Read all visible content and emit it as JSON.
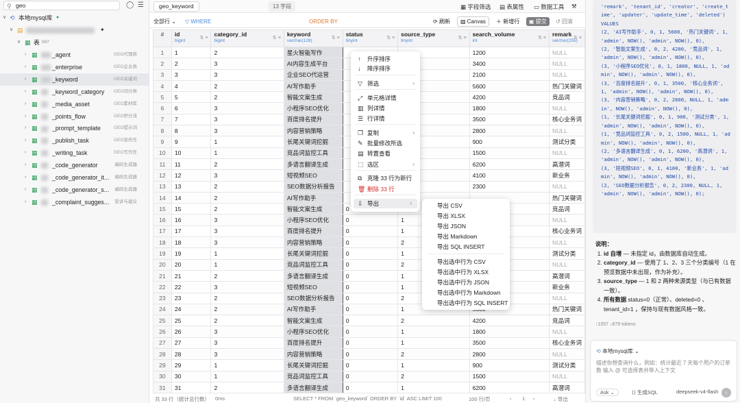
{
  "sidebar": {
    "search_value": "geo",
    "root_label": "本地mysql库",
    "tables_label": "表",
    "tables_count": "597",
    "items": [
      {
        "label": "_agent",
        "note": "GEO代理商"
      },
      {
        "label": "_enterprise",
        "note": "GEO企业表"
      },
      {
        "label": "_keyword",
        "note": "GEO关键词"
      },
      {
        "label": "_keyword_category",
        "note": "GEO词分类"
      },
      {
        "label": "_media_asset",
        "note": "GEO素材库"
      },
      {
        "label": "_points_flow",
        "note": "GEO积分流"
      },
      {
        "label": "_prompt_template",
        "note": "GEO提示词"
      },
      {
        "label": "_publish_task",
        "note": "GEO发布任"
      },
      {
        "label": "_writing_task",
        "note": "GEO写作任"
      },
      {
        "label": "_code_generator",
        "note": "编码生成器"
      },
      {
        "label": "_code_generator_it...",
        "note": "编码生成器"
      },
      {
        "label": "_code_generator_s...",
        "note": "编码生成器"
      },
      {
        "label": "_complaint_sugges...",
        "note": "投诉与建议"
      }
    ]
  },
  "toolbar": {
    "tab_label": "geo_keyword",
    "field_count": "13 字段",
    "field_filter": "字段筛选",
    "table_props": "表属性",
    "data_tools": "数据工具"
  },
  "filterbar": {
    "rows": "全部行",
    "where": "WHERE",
    "order_by": "ORDER BY",
    "refresh": "刷新",
    "canvas": "Canvas",
    "add_row": "新增行",
    "commit": "提交",
    "rollback": "回滚"
  },
  "table": {
    "columns": [
      {
        "name": "#",
        "type": ""
      },
      {
        "name": "id",
        "type": "bigint"
      },
      {
        "name": "category_id",
        "type": "bigint"
      },
      {
        "name": "keyword",
        "type": "varchar(128)"
      },
      {
        "name": "status",
        "type": "tinyint"
      },
      {
        "name": "source_type",
        "type": "tinyint"
      },
      {
        "name": "search_volume",
        "type": "int"
      },
      {
        "name": "remark",
        "type": "varchar(255)"
      }
    ],
    "rows": [
      [
        "1",
        "1",
        "2",
        "星火智能写作",
        "",
        "",
        "1200",
        "NULL"
      ],
      [
        "2",
        "2",
        "3",
        "AI内容生成平台",
        "",
        "",
        "3400",
        "NULL"
      ],
      [
        "3",
        "3",
        "3",
        "企业SEO代运营",
        "",
        "",
        "2100",
        "NULL"
      ],
      [
        "4",
        "4",
        "2",
        "AI写作助手",
        "",
        "",
        "5600",
        "热门关键词"
      ],
      [
        "5",
        "5",
        "2",
        "智能文案生成",
        "",
        "",
        "4200",
        "竞品词"
      ],
      [
        "6",
        "6",
        "3",
        "小程序SEO优化",
        "",
        "",
        "1800",
        "NULL"
      ],
      [
        "7",
        "7",
        "3",
        "百度排名提升",
        "",
        "",
        "3500",
        "核心业务词"
      ],
      [
        "8",
        "8",
        "3",
        "内容营销策略",
        "",
        "",
        "2800",
        "NULL"
      ],
      [
        "9",
        "9",
        "1",
        "长尾关键词挖掘",
        "",
        "",
        "900",
        "测试分类"
      ],
      [
        "10",
        "10",
        "1",
        "竞品词监控工具",
        "",
        "",
        "1500",
        "NULL"
      ],
      [
        "11",
        "11",
        "2",
        "多语言翻译生成",
        "",
        "",
        "6200",
        "高潜词"
      ],
      [
        "12",
        "12",
        "3",
        "短视频SEO",
        "",
        "",
        "4100",
        "新业务"
      ],
      [
        "13",
        "13",
        "2",
        "SEO数据分析报告",
        "",
        "",
        "2300",
        "NULL"
      ],
      [
        "14",
        "14",
        "2",
        "AI写作助手",
        "",
        "",
        "",
        "热门关键词"
      ],
      [
        "15",
        "15",
        "2",
        "智能文案生成",
        "0",
        "",
        "",
        "竞品词"
      ],
      [
        "16",
        "16",
        "3",
        "小程序SEO优化",
        "0",
        "1",
        "",
        "NULL"
      ],
      [
        "17",
        "17",
        "3",
        "百度排名提升",
        "0",
        "1",
        "",
        "核心业务词"
      ],
      [
        "18",
        "18",
        "3",
        "内容营销策略",
        "0",
        "2",
        "",
        "NULL"
      ],
      [
        "19",
        "19",
        "1",
        "长尾关键词挖掘",
        "0",
        "1",
        "",
        "测试分类"
      ],
      [
        "20",
        "20",
        "1",
        "竞品词监控工具",
        "0",
        "2",
        "",
        "NULL"
      ],
      [
        "21",
        "21",
        "2",
        "多语言翻译生成",
        "0",
        "1",
        "",
        "高潜词"
      ],
      [
        "22",
        "22",
        "3",
        "短视频SEO",
        "0",
        "1",
        "",
        "新业务"
      ],
      [
        "23",
        "23",
        "2",
        "SEO数据分析报告",
        "0",
        "2",
        "",
        "NULL"
      ],
      [
        "24",
        "24",
        "2",
        "AI写作助手",
        "0",
        "1",
        "5600",
        "热门关键词"
      ],
      [
        "25",
        "25",
        "2",
        "智能文案生成",
        "0",
        "2",
        "4200",
        "竞品词"
      ],
      [
        "26",
        "26",
        "3",
        "小程序SEO优化",
        "0",
        "1",
        "1800",
        "NULL"
      ],
      [
        "27",
        "27",
        "3",
        "百度排名提升",
        "0",
        "1",
        "3500",
        "核心业务词"
      ],
      [
        "28",
        "28",
        "3",
        "内容营销策略",
        "0",
        "2",
        "2800",
        "NULL"
      ],
      [
        "29",
        "29",
        "1",
        "长尾关键词挖掘",
        "0",
        "1",
        "900",
        "测试分类"
      ],
      [
        "30",
        "30",
        "1",
        "竞品词监控工具",
        "0",
        "2",
        "1500",
        "NULL"
      ],
      [
        "31",
        "31",
        "2",
        "多语言翻译生成",
        "0",
        "1",
        "6200",
        "高潜词"
      ]
    ]
  },
  "context_menu": {
    "items": [
      {
        "label": "升序排序",
        "icon": "arrow-up-icon",
        "arrow": ""
      },
      {
        "label": "降序排序",
        "icon": "arrow-down-icon",
        "arrow": ""
      },
      {
        "label": "筛选",
        "icon": "filter-icon",
        "arrow": "›"
      },
      {
        "label": "单元格详情",
        "icon": "expand-icon",
        "arrow": ""
      },
      {
        "label": "列详情",
        "icon": "column-icon",
        "arrow": ""
      },
      {
        "label": "行详情",
        "icon": "row-icon",
        "arrow": ""
      },
      {
        "label": "复制",
        "icon": "copy-icon",
        "arrow": "›"
      },
      {
        "label": "批量修改所选",
        "icon": "pencil-icon",
        "arrow": ""
      },
      {
        "label": "转置查看",
        "icon": "transpose-icon",
        "arrow": ""
      },
      {
        "label": "选区",
        "icon": "selection-icon",
        "arrow": "›"
      },
      {
        "label": "克隆 33 行为新行",
        "icon": "clone-icon",
        "arrow": ""
      },
      {
        "label": "删除 33 行",
        "icon": "trash-icon",
        "arrow": ""
      },
      {
        "label": "导出",
        "icon": "export-icon",
        "arrow": "›"
      }
    ],
    "export_items": [
      "导出 CSV",
      "导出 XLSX",
      "导出 JSON",
      "导出 Markdown",
      "导出 SQL INSERT",
      "导出选中行为 CSV",
      "导出选中行为 XLSX",
      "导出选中行为 JSON",
      "导出选中行为 Markdown",
      "导出选中行为 SQL INSERT"
    ]
  },
  "statusbar": {
    "rows": "共 33 行（统计总行数）",
    "time": "0ms",
    "sql": "SELECT * FROM `geo_keyword` ORDER BY `id` ASC LIMIT 100",
    "page_size": "100 行/页",
    "page": "1",
    "export": "导出"
  },
  "right_panel": {
    "code": "'remark', 'tenant_id', 'creator', 'create_time', 'updater', 'update_time', 'deleted') VALUES\n(2, 'AI写作助手', 0, 1, 5600, '热门关键词', 1, 'admin', NOW(), 'admin', NOW(), 0),\n(2, '智能文案生成', 0, 2, 4200, '竞品词', 1, 'admin', NOW(), 'admin', NOW(), 0),\n(3, '小程序SEO优化', 0, 1, 1800, NULL, 1, 'admin', NOW(), 'admin', NOW(), 0),\n(3, '百度排名提升', 0, 1, 3500, '核心业务词', 1, 'admin', NOW(), 'admin', NOW(), 0),\n(3, '内容营销策略', 0, 2, 2800, NULL, 1, 'admin', NOW(), 'admin', NOW(), 0),\n(1, '长尾关键词挖掘', 0, 1, 900, '测试分类', 1, 'admin', NOW(), 'admin', NOW(), 0),\n(1, '竞品词监控工具', 0, 2, 1500, NULL, 1, 'admin', NOW(), 'admin', NOW(), 0),\n(2, '多语言翻译生成', 0, 1, 6200, '高潜词', 1, 'admin', NOW(), 'admin', NOW(), 0),\n(3, '短视频SEO', 0, 1, 4100, '新业务', 1, 'admin', NOW(), 'admin', NOW(), 0),\n(2, 'SEO数据分析报告', 0, 2, 2300, NULL, 1, 'admin', NOW(), 'admin', NOW(), 0);",
    "notes_title": "说明：",
    "notes": [
      {
        "key": "id 自增",
        "text": " — 未指定 id，由数据库自动生成。"
      },
      {
        "key": "category_id",
        "text": " — 使用了 1、2、3 三个分类编号（1 在预览数据中未出现，作为补充）。"
      },
      {
        "key": "source_type",
        "text": " — 1 和 2 两种来源类型（与已有数据一致）。"
      },
      {
        "key": "所有数据",
        "text": " status=0（正常）、deleted=0 、tenant_id=1 ，保持与现有数据风格一致。"
      }
    ],
    "tokens": "↑1557 ↓879 tokens",
    "chat_db": "本地mysql库",
    "chat_placeholder": "描述你想查询什么，例如：统计最近 7 天每个用户的订单数 输入 @ 可选择表并带入上下文",
    "mode": "Ask",
    "gen_sql": "生成SQL",
    "model": "deepseek-v4-flash"
  }
}
